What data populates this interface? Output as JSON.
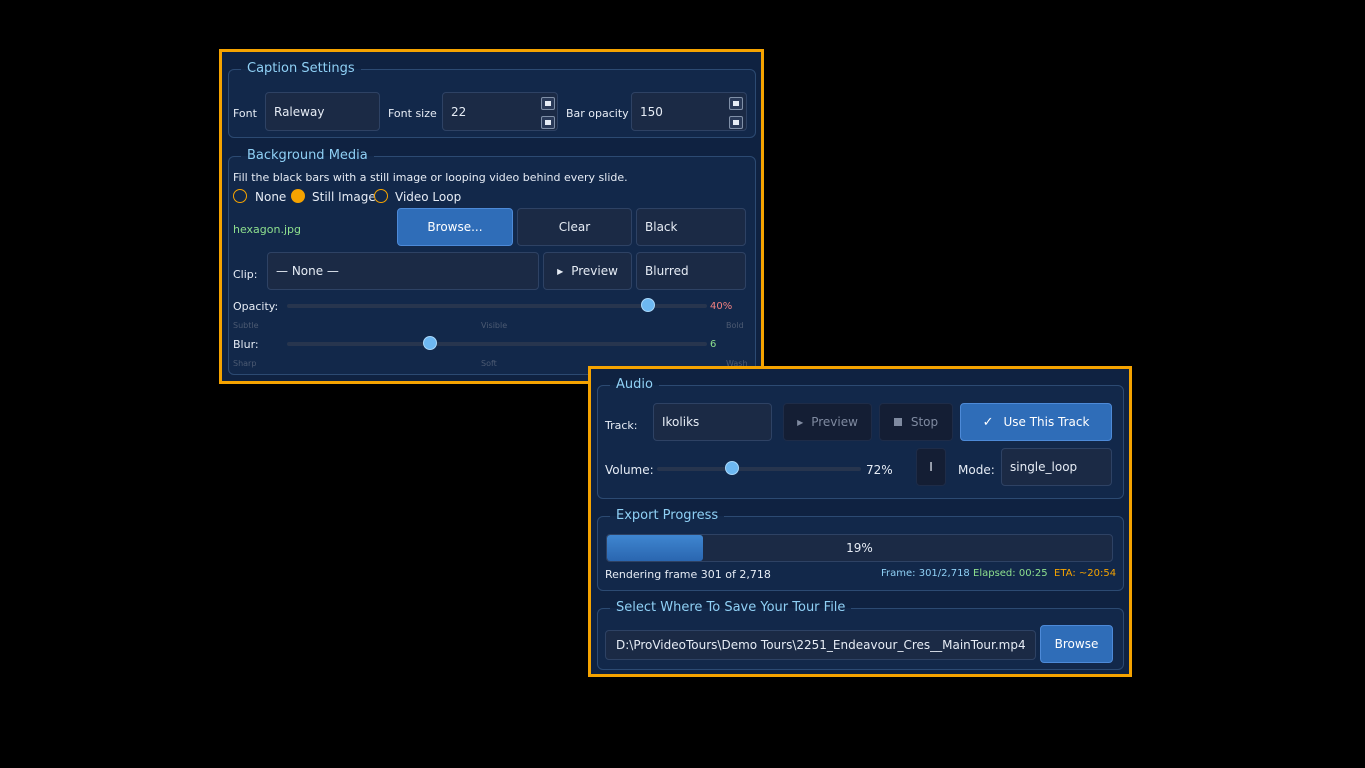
{
  "colors": {
    "accent": "#f5a300",
    "panel": "#0f2241",
    "primary": "#2f6db8",
    "legend": "#8fd0f5",
    "green": "#8ee08e",
    "red": "#f08080"
  },
  "caption": {
    "legend": "Caption Settings",
    "font_label": "Font",
    "font_value": "Raleway",
    "size_label": "Font size",
    "size_value": "22",
    "opacity_label": "Bar opacity",
    "opacity_value": "150"
  },
  "bg": {
    "legend": "Background Media",
    "desc": "Fill the black bars with a still image or looping video behind every slide.",
    "radios": [
      {
        "label": "None",
        "checked": false
      },
      {
        "label": "Still Image",
        "checked": true
      },
      {
        "label": "Video Loop",
        "checked": false
      }
    ],
    "file": "hexagon.jpg",
    "browse": "Browse...",
    "clear": "Clear",
    "fill_mode": "Black",
    "clip_label": "Clip:",
    "clip_value": "— None —",
    "preview_icon": "play-icon",
    "preview": "Preview",
    "blur_mode": "Blurred",
    "opacity": {
      "label": "Opacity:",
      "value": 0.86,
      "readout": "40%",
      "ticks": [
        "Subtle",
        "Visible",
        "Bold"
      ]
    },
    "blur": {
      "label": "Blur:",
      "value": 0.34,
      "readout": "6",
      "ticks": [
        "Sharp",
        "Soft",
        "Wash"
      ]
    }
  },
  "audio": {
    "legend": "Audio",
    "track_label": "Track:",
    "track_value": "Ikoliks",
    "preview_icon": "play-icon",
    "preview": "Preview",
    "stop_icon": "stop-icon",
    "stop": "Stop",
    "use_icon": "check-icon",
    "use": "Use This Track",
    "volume_label": "Volume:",
    "volume": 0.37,
    "volume_readout": "72%",
    "cursor_glyph": "I",
    "mode_label": "Mode:",
    "mode_value": "single_loop"
  },
  "export": {
    "legend": "Export Progress",
    "progress": 0.19,
    "percent_text": "19%",
    "status": "Rendering frame 301 of 2,718",
    "frame": "Frame: 301/2,718",
    "elapsed": "Elapsed: 00:25",
    "eta": "ETA: ~20:54"
  },
  "save": {
    "legend": "Select Where To Save Your Tour File",
    "path": "D:\\ProVideoTours\\Demo Tours\\2251_Endeavour_Cres__MainTour.mp4",
    "browse": "Browse"
  }
}
